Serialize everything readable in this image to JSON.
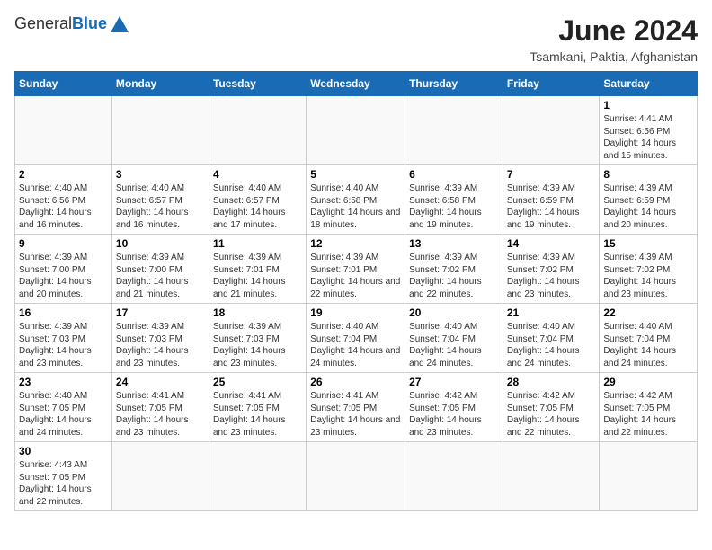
{
  "header": {
    "logo_general": "General",
    "logo_blue": "Blue",
    "month_title": "June 2024",
    "location": "Tsamkani, Paktia, Afghanistan"
  },
  "weekdays": [
    "Sunday",
    "Monday",
    "Tuesday",
    "Wednesday",
    "Thursday",
    "Friday",
    "Saturday"
  ],
  "weeks": [
    [
      {
        "num": "",
        "info": ""
      },
      {
        "num": "",
        "info": ""
      },
      {
        "num": "",
        "info": ""
      },
      {
        "num": "",
        "info": ""
      },
      {
        "num": "",
        "info": ""
      },
      {
        "num": "",
        "info": ""
      },
      {
        "num": "1",
        "info": "Sunrise: 4:41 AM\nSunset: 6:56 PM\nDaylight: 14 hours\nand 15 minutes."
      }
    ],
    [
      {
        "num": "2",
        "info": "Sunrise: 4:40 AM\nSunset: 6:56 PM\nDaylight: 14 hours\nand 16 minutes."
      },
      {
        "num": "3",
        "info": "Sunrise: 4:40 AM\nSunset: 6:57 PM\nDaylight: 14 hours\nand 16 minutes."
      },
      {
        "num": "4",
        "info": "Sunrise: 4:40 AM\nSunset: 6:57 PM\nDaylight: 14 hours\nand 17 minutes."
      },
      {
        "num": "5",
        "info": "Sunrise: 4:40 AM\nSunset: 6:58 PM\nDaylight: 14 hours\nand 18 minutes."
      },
      {
        "num": "6",
        "info": "Sunrise: 4:39 AM\nSunset: 6:58 PM\nDaylight: 14 hours\nand 19 minutes."
      },
      {
        "num": "7",
        "info": "Sunrise: 4:39 AM\nSunset: 6:59 PM\nDaylight: 14 hours\nand 19 minutes."
      },
      {
        "num": "8",
        "info": "Sunrise: 4:39 AM\nSunset: 6:59 PM\nDaylight: 14 hours\nand 20 minutes."
      }
    ],
    [
      {
        "num": "9",
        "info": "Sunrise: 4:39 AM\nSunset: 7:00 PM\nDaylight: 14 hours\nand 20 minutes."
      },
      {
        "num": "10",
        "info": "Sunrise: 4:39 AM\nSunset: 7:00 PM\nDaylight: 14 hours\nand 21 minutes."
      },
      {
        "num": "11",
        "info": "Sunrise: 4:39 AM\nSunset: 7:01 PM\nDaylight: 14 hours\nand 21 minutes."
      },
      {
        "num": "12",
        "info": "Sunrise: 4:39 AM\nSunset: 7:01 PM\nDaylight: 14 hours\nand 22 minutes."
      },
      {
        "num": "13",
        "info": "Sunrise: 4:39 AM\nSunset: 7:02 PM\nDaylight: 14 hours\nand 22 minutes."
      },
      {
        "num": "14",
        "info": "Sunrise: 4:39 AM\nSunset: 7:02 PM\nDaylight: 14 hours\nand 23 minutes."
      },
      {
        "num": "15",
        "info": "Sunrise: 4:39 AM\nSunset: 7:02 PM\nDaylight: 14 hours\nand 23 minutes."
      }
    ],
    [
      {
        "num": "16",
        "info": "Sunrise: 4:39 AM\nSunset: 7:03 PM\nDaylight: 14 hours\nand 23 minutes."
      },
      {
        "num": "17",
        "info": "Sunrise: 4:39 AM\nSunset: 7:03 PM\nDaylight: 14 hours\nand 23 minutes."
      },
      {
        "num": "18",
        "info": "Sunrise: 4:39 AM\nSunset: 7:03 PM\nDaylight: 14 hours\nand 23 minutes."
      },
      {
        "num": "19",
        "info": "Sunrise: 4:40 AM\nSunset: 7:04 PM\nDaylight: 14 hours\nand 24 minutes."
      },
      {
        "num": "20",
        "info": "Sunrise: 4:40 AM\nSunset: 7:04 PM\nDaylight: 14 hours\nand 24 minutes."
      },
      {
        "num": "21",
        "info": "Sunrise: 4:40 AM\nSunset: 7:04 PM\nDaylight: 14 hours\nand 24 minutes."
      },
      {
        "num": "22",
        "info": "Sunrise: 4:40 AM\nSunset: 7:04 PM\nDaylight: 14 hours\nand 24 minutes."
      }
    ],
    [
      {
        "num": "23",
        "info": "Sunrise: 4:40 AM\nSunset: 7:05 PM\nDaylight: 14 hours\nand 24 minutes."
      },
      {
        "num": "24",
        "info": "Sunrise: 4:41 AM\nSunset: 7:05 PM\nDaylight: 14 hours\nand 23 minutes."
      },
      {
        "num": "25",
        "info": "Sunrise: 4:41 AM\nSunset: 7:05 PM\nDaylight: 14 hours\nand 23 minutes."
      },
      {
        "num": "26",
        "info": "Sunrise: 4:41 AM\nSunset: 7:05 PM\nDaylight: 14 hours\nand 23 minutes."
      },
      {
        "num": "27",
        "info": "Sunrise: 4:42 AM\nSunset: 7:05 PM\nDaylight: 14 hours\nand 23 minutes."
      },
      {
        "num": "28",
        "info": "Sunrise: 4:42 AM\nSunset: 7:05 PM\nDaylight: 14 hours\nand 22 minutes."
      },
      {
        "num": "29",
        "info": "Sunrise: 4:42 AM\nSunset: 7:05 PM\nDaylight: 14 hours\nand 22 minutes."
      }
    ],
    [
      {
        "num": "30",
        "info": "Sunrise: 4:43 AM\nSunset: 7:05 PM\nDaylight: 14 hours\nand 22 minutes."
      },
      {
        "num": "",
        "info": ""
      },
      {
        "num": "",
        "info": ""
      },
      {
        "num": "",
        "info": ""
      },
      {
        "num": "",
        "info": ""
      },
      {
        "num": "",
        "info": ""
      },
      {
        "num": "",
        "info": ""
      }
    ]
  ]
}
